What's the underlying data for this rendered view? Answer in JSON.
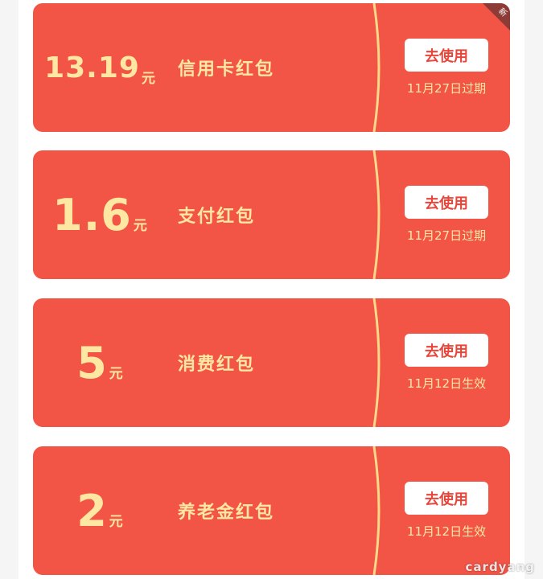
{
  "cards": [
    {
      "amount": "13.19",
      "unit": "元",
      "title": "信用卡红包",
      "button": "去使用",
      "status": "11月27日过期",
      "badge": "新"
    },
    {
      "amount": "1.6",
      "unit": "元",
      "title": "支付红包",
      "button": "去使用",
      "status": "11月27日过期"
    },
    {
      "amount": "5",
      "unit": "元",
      "title": "消费红包",
      "button": "去使用",
      "status": "11月12日生效"
    },
    {
      "amount": "2",
      "unit": "元",
      "title": "养老金红包",
      "button": "去使用",
      "status": "11月12日生效"
    }
  ],
  "watermark": "cardyang",
  "colors": {
    "card_bg": "#f25445",
    "accent_text": "#fde7a3",
    "button_bg": "#ffffff",
    "button_text": "#e8463a",
    "divider": "#ffd98a",
    "badge_bg": "#8c3b36"
  }
}
